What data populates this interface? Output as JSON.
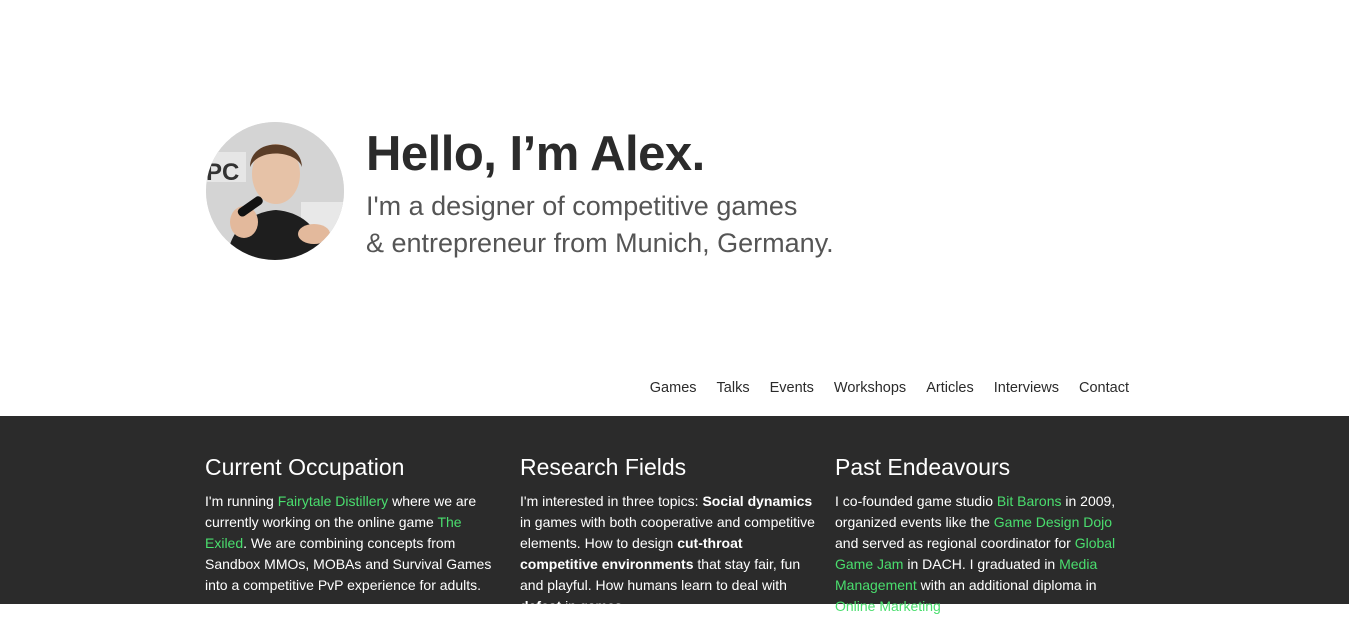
{
  "hero": {
    "title": "Hello, I’m Alex.",
    "tagline_line1": "I'm a designer of competitive games",
    "tagline_line2": "& entrepreneur from Munich, Germany."
  },
  "nav": {
    "items": [
      "Games",
      "Talks",
      "Events",
      "Workshops",
      "Articles",
      "Interviews",
      "Contact"
    ]
  },
  "columns": [
    {
      "title": "Current Occupation",
      "text": {
        "t1": "I'm running ",
        "l1": "Fairytale Distillery",
        "t2": " where we are currently working on the online game ",
        "l2": "The Exiled",
        "t3": ". We are combining concepts from Sandbox MMOs, MOBAs and Survival Games into a competitive PvP experience for adults."
      }
    },
    {
      "title": "Research Fields",
      "text": {
        "t1": "I'm interested in three topics: ",
        "b1": "Social dynamics",
        "t2": " in games with both cooperative and competitive elements. How to design ",
        "b2": "cut-throat competitive environments",
        "t3": " that stay fair, fun and playful. How humans learn to deal with ",
        "b3": "defeat",
        "t4": " in games."
      }
    },
    {
      "title": "Past Endeavours",
      "text": {
        "t1": "I co-founded game studio ",
        "l1": "Bit Barons",
        "t2": " in 2009, organized events like the ",
        "l2": "Game Design Dojo",
        "t3": " and served as regional coordinator for ",
        "l3": "Global Game Jam",
        "t4": " in DACH. I graduated in ",
        "l4": "Media Management",
        "t5": " with an additional diploma in ",
        "l5": "Online Marketing",
        "t6": "."
      }
    }
  ],
  "colors": {
    "link": "#4ade6e",
    "dark_bg": "#2b2b2b",
    "heading": "#2b2b2b"
  }
}
